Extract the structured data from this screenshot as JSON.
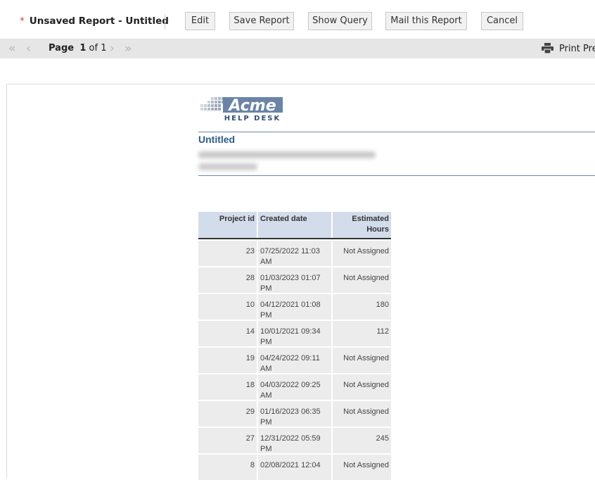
{
  "toolbar": {
    "unsaved_marker": "*",
    "title": "Unsaved Report - Untitled",
    "edit_label": "Edit",
    "save_label": "Save Report",
    "show_query_label": "Show Query",
    "mail_label": "Mail this Report",
    "cancel_label": "Cancel"
  },
  "pager": {
    "page_word": "Page",
    "current_page": "1",
    "of_text": "of 1",
    "print_label": "Print Pre"
  },
  "report": {
    "logo_text": "Acme",
    "logo_sub": "HELP DESK",
    "title": "Untitled",
    "columns": [
      "Project id",
      "Created date",
      "Estimated Hours"
    ],
    "rows": [
      {
        "id": "23",
        "created": "07/25/2022 11:03 AM",
        "hours": "Not Assigned"
      },
      {
        "id": "28",
        "created": "01/03/2023 01:07 PM",
        "hours": "Not Assigned"
      },
      {
        "id": "10",
        "created": "04/12/2021 01:08 PM",
        "hours": "180"
      },
      {
        "id": "14",
        "created": "10/01/2021 09:34 PM",
        "hours": "112"
      },
      {
        "id": "19",
        "created": "04/24/2022 09:11 AM",
        "hours": "Not Assigned"
      },
      {
        "id": "18",
        "created": "04/03/2022 09:25 AM",
        "hours": "Not Assigned"
      },
      {
        "id": "29",
        "created": "01/16/2023 06:35 PM",
        "hours": "Not Assigned"
      },
      {
        "id": "27",
        "created": "12/31/2022 05:59 PM",
        "hours": "245"
      },
      {
        "id": "8",
        "created": "02/08/2021 12:04",
        "hours": "Not Assigned"
      }
    ]
  },
  "colors": {
    "title_blue": "#2a5a8e",
    "header_bg": "#d3dcea",
    "cell_bg": "#ececec",
    "unsaved_red": "#d64040"
  }
}
